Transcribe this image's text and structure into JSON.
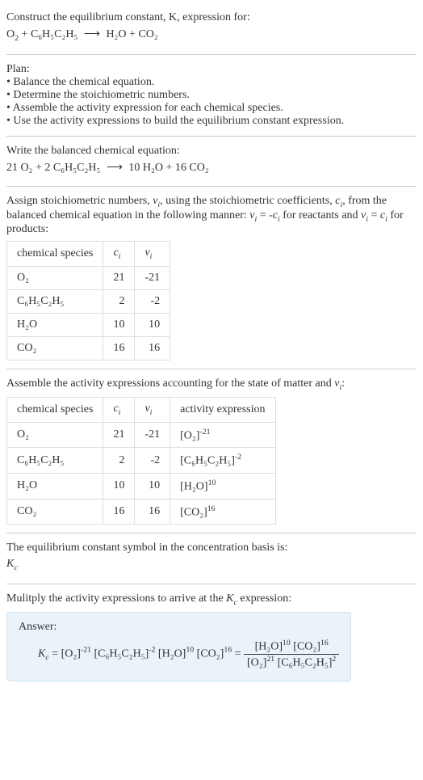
{
  "intro": {
    "line1": "Construct the equilibrium constant, K, expression for:",
    "eq_lhs_o2": "O",
    "eq_plus": " + ",
    "eq_lhs_eb": "C₆H₅C₂H₅",
    "arrow": "⟶",
    "eq_rhs_h2o": "H₂O",
    "eq_rhs_co2": "CO₂"
  },
  "plan": {
    "heading": "Plan:",
    "b1": "• Balance the chemical equation.",
    "b2": "• Determine the stoichiometric numbers.",
    "b3": "• Assemble the activity expression for each chemical species.",
    "b4": "• Use the activity expressions to build the equilibrium constant expression."
  },
  "balanced": {
    "heading": "Write the balanced chemical equation:",
    "c_o2": "21",
    "o2": "O₂",
    "plus1": " + ",
    "c_eb": "2",
    "eb": "C₆H₅C₂H₅",
    "arrow": "⟶",
    "c_h2o": "10",
    "h2o": "H₂O",
    "plus2": " + ",
    "c_co2": "16",
    "co2": "CO₂"
  },
  "stoich_text": {
    "l1a": "Assign stoichiometric numbers, ",
    "nu": "ν",
    "sub_i": "i",
    "l1b": ", using the stoichiometric coefficients, ",
    "c": "c",
    "l1c": ", from",
    "l2a": "the balanced chemical equation in the following manner: ",
    "l2b": " = -",
    "l2c": " for reactants",
    "l3a": "and ",
    "l3b": " = ",
    "l3c": " for products:"
  },
  "table1": {
    "h1": "chemical species",
    "h2": "cᵢ",
    "h3": "νᵢ",
    "r1": {
      "sp": "O₂",
      "c": "21",
      "v": "-21"
    },
    "r2": {
      "sp": "C₆H₅C₂H₅",
      "c": "2",
      "v": "-2"
    },
    "r3": {
      "sp": "H₂O",
      "c": "10",
      "v": "10"
    },
    "r4": {
      "sp": "CO₂",
      "c": "16",
      "v": "16"
    }
  },
  "activity_text": "Assemble the activity expressions accounting for the state of matter and νᵢ:",
  "table2": {
    "h1": "chemical species",
    "h2": "cᵢ",
    "h3": "νᵢ",
    "h4": "activity expression",
    "r1": {
      "sp": "O₂",
      "c": "21",
      "v": "-21",
      "a": "[O₂]",
      "e": "-21"
    },
    "r2": {
      "sp": "C₆H₅C₂H₅",
      "c": "2",
      "v": "-2",
      "a": "[C₆H₅C₂H₅]",
      "e": "-2"
    },
    "r3": {
      "sp": "H₂O",
      "c": "10",
      "v": "10",
      "a": "[H₂O]",
      "e": "10"
    },
    "r4": {
      "sp": "CO₂",
      "c": "16",
      "v": "16",
      "a": "[CO₂]",
      "e": "16"
    }
  },
  "symbol_text": {
    "l1": "The equilibrium constant symbol in the concentration basis is:",
    "kc": "K",
    "kc_sub": "c"
  },
  "multiply_text": "Mulitply the activity expressions to arrive at the Kc expression:",
  "answer": {
    "label": "Answer:",
    "kc": "K",
    "kc_sub": "c",
    "eq": " = ",
    "t1": "[O₂]",
    "e1": "-21",
    "sp": " ",
    "t2": "[C₆H₅C₂H₅]",
    "e2": "-2",
    "t3": "[H₂O]",
    "e3": "10",
    "t4": "[CO₂]",
    "e4": "16",
    "eq2": " = ",
    "num1": "[H₂O]",
    "ne1": "10",
    "num2": "[CO₂]",
    "ne2": "16",
    "den1": "[O₂]",
    "de1": "21",
    "den2": "[C₆H₅C₂H₅]",
    "de2": "2"
  }
}
